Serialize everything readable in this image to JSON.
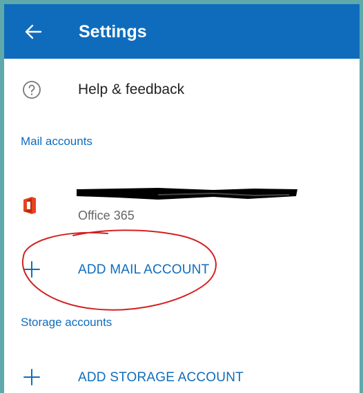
{
  "header": {
    "title": "Settings",
    "back_icon": "arrow-left-icon"
  },
  "help": {
    "label": "Help & feedback",
    "icon": "question-circle-icon"
  },
  "mail_accounts": {
    "section_label": "Mail accounts",
    "accounts": [
      {
        "email": "",
        "type": "Office 365",
        "icon": "office-icon"
      }
    ],
    "add_label": "ADD MAIL ACCOUNT"
  },
  "storage_accounts": {
    "section_label": "Storage accounts",
    "add_label": "ADD STORAGE ACCOUNT"
  },
  "colors": {
    "accent": "#0f6cbd",
    "annotation": "#d42020",
    "office": "#e8421f"
  }
}
